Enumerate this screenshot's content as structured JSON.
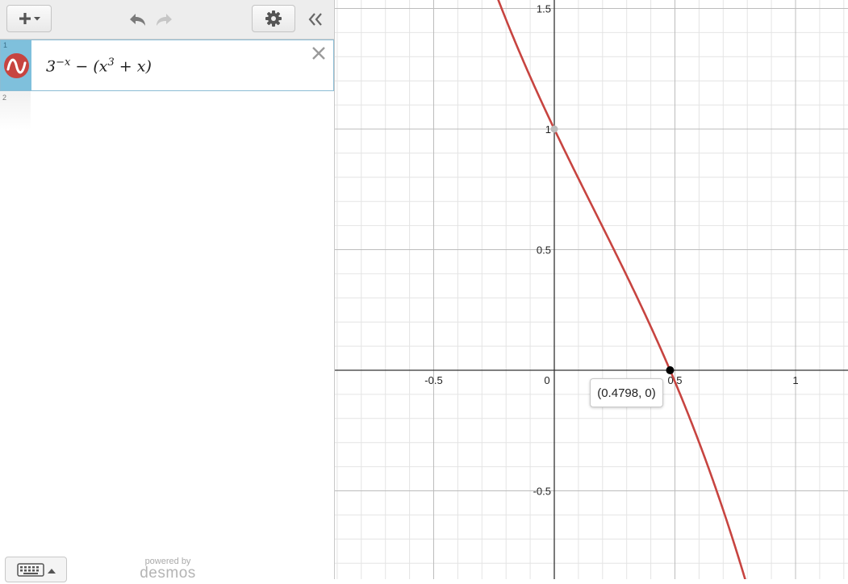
{
  "toolbar": {
    "add_icon": "plus-icon",
    "undo_icon": "undo-arrow-icon",
    "redo_icon": "redo-arrow-icon",
    "settings_icon": "wrench-gear-icon",
    "collapse_icon": "double-chevron-left-icon"
  },
  "expressions": [
    {
      "index": "1",
      "base": "3",
      "exponent": "−x",
      "rest": "− (x",
      "cube_exp": "3",
      "tail": " + x)",
      "color": "#c74440"
    },
    {
      "index": "2"
    }
  ],
  "footer": {
    "powered_by": "powered by",
    "brand": "desmos",
    "keyboard_icon": "keyboard-icon"
  },
  "graph": {
    "x_ticks": [
      "-0.5",
      "0",
      "0.5",
      "1"
    ],
    "y_ticks": [
      "1.5",
      "1",
      "0.5",
      "-0.5"
    ],
    "point_label": "(0.4798, 0)",
    "curve_color": "#c74440"
  },
  "chart_data": {
    "type": "line",
    "title": "",
    "xlabel": "",
    "ylabel": "",
    "xlim": [
      -0.9,
      1.22
    ],
    "ylim": [
      -0.87,
      1.53
    ],
    "grid": true,
    "series": [
      {
        "name": "3^{-x} - (x^3 + x)",
        "function": "3^(-x) - (x^3 + x)"
      }
    ],
    "points": [
      {
        "x": 0,
        "y": 1,
        "color": "#bbbbbb"
      },
      {
        "x": 0.4798,
        "y": 0,
        "label": "(0.4798, 0)",
        "color": "#000000"
      }
    ]
  }
}
